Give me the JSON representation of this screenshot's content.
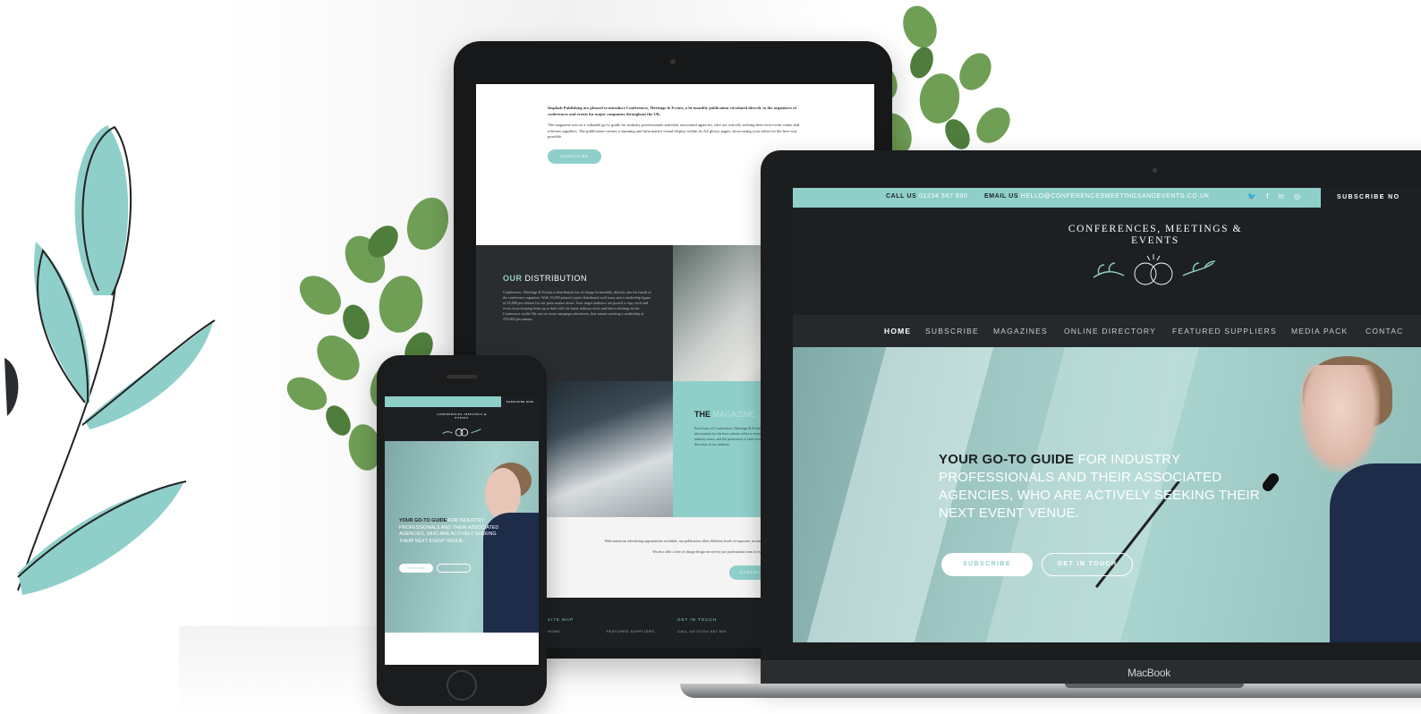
{
  "colors": {
    "accent": "#8fcfc9",
    "dark": "#1d2022",
    "nav": "#26292c",
    "white": "#ffffff"
  },
  "laptop": {
    "brand_label": "MacBook",
    "topbar": {
      "call_label": "CALL US",
      "call_value": "01234 567 890",
      "email_label": "EMAIL US",
      "email_value": "HELLO@CONFERENCESMEETINGSANDEVENTS.CO.UK",
      "social_icons": [
        "twitter-icon",
        "facebook-icon",
        "linkedin-icon",
        "instagram-icon"
      ],
      "social_glyphs": [
        "🐦",
        "f",
        "in",
        "◎"
      ],
      "subscribe_now": "SUBSCRIBE NO"
    },
    "logo_text": "CONFERENCES, MEETINGS & EVENTS",
    "nav": [
      "HOME",
      "SUBSCRIBE",
      "MAGAZINES",
      "ONLINE DIRECTORY",
      "FEATURED SUPPLIERS",
      "MEDIA PACK",
      "CONTAC"
    ],
    "hero": {
      "headline_strong": "YOUR GO-TO GUIDE",
      "headline_rest": " FOR INDUSTRY PROFESSIONALS AND THEIR ASSOCIATED AGENCIES, WHO ARE ACTIVELY SEEKING THEIR NEXT EVENT VENUE.",
      "primary_button": "SUBSCRIBE",
      "secondary_button": "GET IN TOUCH"
    }
  },
  "tablet": {
    "intro_lead": "Insplash Publishing are pleased to introduce Conferences, Meetings & Events, a bi-monthly publication circulated directly to the organisers of conferences and events for major companies throughout the UK.",
    "intro_body": "The magazine acts as a valuable go-to guide for industry professionals and their associated agencies, who are actively seeking their next event venue and relevant suppliers. The publication creates a stunning and informative visual display within its A4 glossy pages, showcasing your advert in the best way possible.",
    "intro_button": "SUBSCRIBE",
    "distribution": {
      "heading_strong": "OUR",
      "heading_rest": " DISTRIBUTION",
      "body": "Conferences, Meetings & Events is distributed free of charge bi-monthly, directly into the hands of the conference organiser. With 15,000 printed copies distributed each issue and a readership figure of 45,000 per edition for our print market alone. Your target audience are posted a copy each and every issue keeping them up to date with the latest industry news and latest offerings in the Conference world. Pat our six issue campaign advertisers, that means reaching a readership of 270,000 per annum."
    },
    "magazine": {
      "heading_strong": "THE",
      "heading_rest": " MAGAZINE",
      "body": "Each issue of Conferences, Meetings & Events is full of features on how to be secretly successful, and tips and information for the best website offers a versatile conference directory. Our magazine dedicates one feature to industry news, and the promotion of each event. Are we fully informed on the latest industry thinking, and a future direction of our industry."
    },
    "offer": {
      "line1": "With numerous advertising opportunities available, our publication offers different levels of exposure, accommodating all requirements and budgets.",
      "line2": "We also offer a free of charge design service by our professional team if required.",
      "button": "CONTACT US"
    },
    "footer": {
      "site_map_heading": "SITE MAP",
      "site_map_items": [
        "HOME",
        "FEATURED SUPPLIERS"
      ],
      "contact_heading": "GET IN TOUCH",
      "contact_line": "CALL US 01234 567 890"
    }
  },
  "phone": {
    "subscribe_now": "SUBSCRIBE NOW",
    "logo_text": "CONFERENCES, MEETINGS & EVENTS",
    "hero": {
      "headline_strong": "YOUR GO-TO GUIDE",
      "headline_rest": " FOR INDUSTRY PROFESSIONALS AND THEIR ASSOCIATED AGENCIES, WHO ARE ACTIVELY SEEKING THEIR NEXT EVENT VENUE.",
      "primary_button": "SUBSCRIBE"
    }
  }
}
